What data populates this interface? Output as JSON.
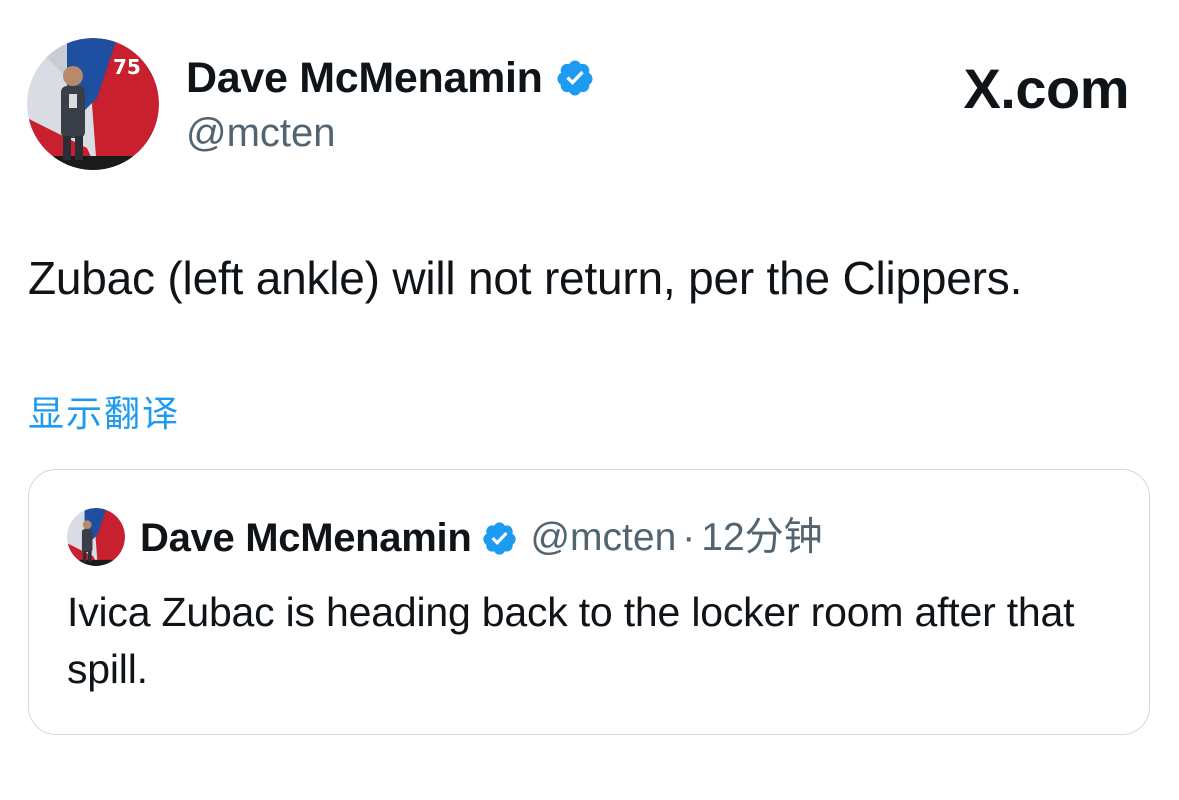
{
  "tweet": {
    "author": {
      "name": "Dave McMenamin",
      "handle": "@mcten",
      "verified": true,
      "avatar_icon": "profile-photo-nba-75-logo"
    },
    "site_label": "X.com",
    "text": "Zubac (left ankle) will not return, per the Clippers.",
    "translate_label": "显示翻译"
  },
  "quoted_tweet": {
    "author": {
      "name": "Dave McMenamin",
      "handle": "@mcten",
      "verified": true
    },
    "separator": "·",
    "time": "12分钟",
    "text": "Ivica Zubac is heading back to the locker room after that spill."
  },
  "colors": {
    "link_blue": "#1d9bf0",
    "verified_blue": "#1d9bf0",
    "secondary_text": "#536471",
    "border": "#cfd9de",
    "primary_text": "#0f1419"
  }
}
